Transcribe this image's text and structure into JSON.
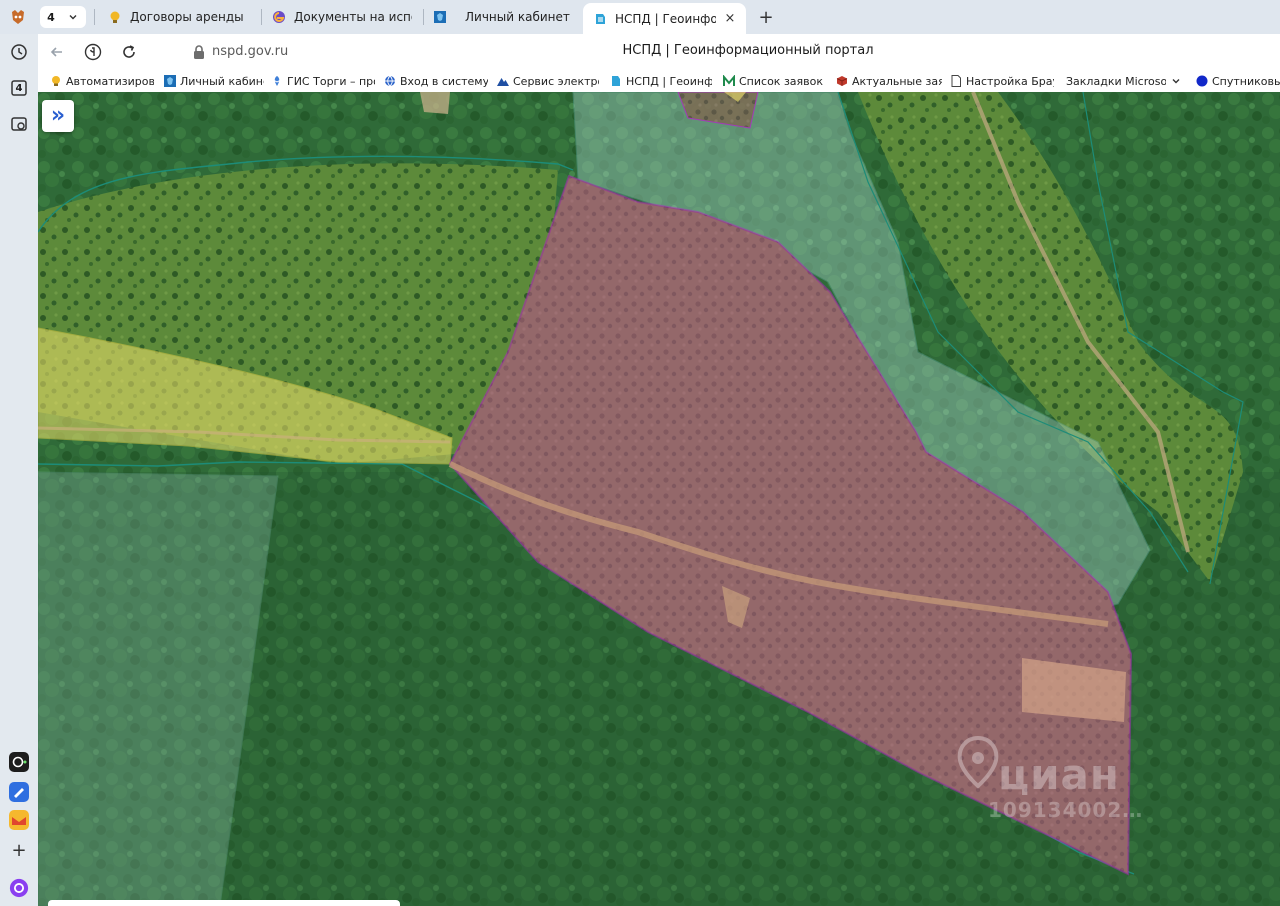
{
  "window": {
    "tabs_count": "4",
    "tabs": [
      {
        "label": "Договоры аренды земли",
        "active": false
      },
      {
        "label": "Документы на исполнени",
        "active": false
      },
      {
        "label": "Личный кабинет",
        "active": false
      },
      {
        "label": "НСПД | Геоинформаци",
        "active": true
      }
    ],
    "close_glyph": "×",
    "new_tab_glyph": "+"
  },
  "sidebar": {
    "badge": "4",
    "bottom_add": "+"
  },
  "toolbar": {
    "url": "nspd.gov.ru",
    "page_title": "НСПД | Геоинформационный портал"
  },
  "bookmarks": [
    {
      "label": "Автоматизирован",
      "icon": "bulb-icon"
    },
    {
      "label": "Личный кабинет",
      "icon": "emblem-icon"
    },
    {
      "label": "ГИС Торги – прод",
      "icon": "gis-icon"
    },
    {
      "label": "Вход в систему :: I",
      "icon": "globe-icon"
    },
    {
      "label": "Сервис электрони",
      "icon": "mountain-icon"
    },
    {
      "label": "НСПД | Геоинфор",
      "icon": "nspd-icon"
    },
    {
      "label": "Список заявок —",
      "icon": "m-icon"
    },
    {
      "label": "Актуальные заяв",
      "icon": "cube-icon"
    },
    {
      "label": "Настройка Брауз",
      "icon": "page-icon"
    },
    {
      "label": "Закладки Microsoft",
      "icon": "folder-icon"
    },
    {
      "label": "Спутниковые",
      "icon": "dot-icon"
    }
  ],
  "map": {
    "expand_glyph": "»",
    "watermark_brand": "циан",
    "watermark_id": "109134002…",
    "colors": {
      "selected_parcel_fill": "#b06a8a",
      "selected_parcel_stroke": "#b325c9",
      "road_fill": "#f0e26a",
      "boundary_stroke": "#1d8c78",
      "forest_zone_fill": "#bde6e6"
    }
  }
}
